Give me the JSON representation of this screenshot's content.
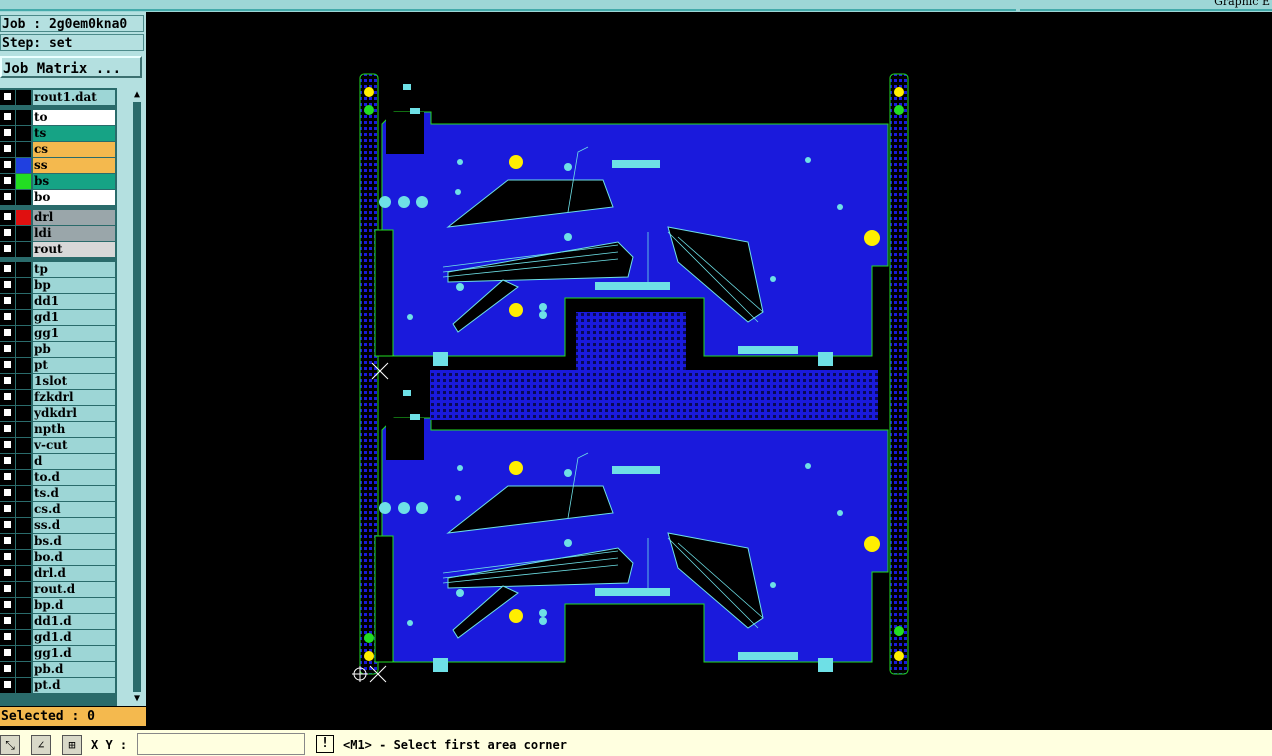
{
  "header": {
    "title": "Graphic E"
  },
  "job": {
    "job_label": "Job : 2g0em0kna0",
    "step_label": "Step: set"
  },
  "matrix_button": "Job Matrix ...",
  "layers": [
    {
      "name": "rout1.dat",
      "color": "#9dd6d6",
      "swatch": ""
    },
    {
      "name": "to",
      "color": "#ffffff",
      "swatch": ""
    },
    {
      "name": "ts",
      "color": "#16a385",
      "swatch": ""
    },
    {
      "name": "cs",
      "color": "#f4b94e",
      "swatch": ""
    },
    {
      "name": "ss",
      "color": "#f4b94e",
      "swatch": "#2040e0"
    },
    {
      "name": "bs",
      "color": "#16a385",
      "swatch": "#22dd22"
    },
    {
      "name": "bo",
      "color": "#ffffff",
      "swatch": ""
    },
    {
      "name": "drl",
      "color": "#9aa6aa",
      "swatch": "#e01010"
    },
    {
      "name": "ldi",
      "color": "#9aa6aa",
      "swatch": ""
    },
    {
      "name": "rout",
      "color": "#d8d8d8",
      "swatch": ""
    },
    {
      "name": "tp",
      "color": "#9dd6d6",
      "swatch": ""
    },
    {
      "name": "bp",
      "color": "#9dd6d6",
      "swatch": ""
    },
    {
      "name": "dd1",
      "color": "#9dd6d6",
      "swatch": ""
    },
    {
      "name": "gd1",
      "color": "#9dd6d6",
      "swatch": ""
    },
    {
      "name": "gg1",
      "color": "#9dd6d6",
      "swatch": ""
    },
    {
      "name": "pb",
      "color": "#9dd6d6",
      "swatch": ""
    },
    {
      "name": "pt",
      "color": "#9dd6d6",
      "swatch": ""
    },
    {
      "name": "1slot",
      "color": "#9dd6d6",
      "swatch": ""
    },
    {
      "name": "fzkdrl",
      "color": "#9dd6d6",
      "swatch": ""
    },
    {
      "name": "ydkdrl",
      "color": "#9dd6d6",
      "swatch": ""
    },
    {
      "name": "npth",
      "color": "#9dd6d6",
      "swatch": ""
    },
    {
      "name": "v-cut",
      "color": "#9dd6d6",
      "swatch": ""
    },
    {
      "name": "d",
      "color": "#9dd6d6",
      "swatch": ""
    },
    {
      "name": "to.d",
      "color": "#9dd6d6",
      "swatch": ""
    },
    {
      "name": "ts.d",
      "color": "#9dd6d6",
      "swatch": ""
    },
    {
      "name": "cs.d",
      "color": "#9dd6d6",
      "swatch": ""
    },
    {
      "name": "ss.d",
      "color": "#9dd6d6",
      "swatch": ""
    },
    {
      "name": "bs.d",
      "color": "#9dd6d6",
      "swatch": ""
    },
    {
      "name": "bo.d",
      "color": "#9dd6d6",
      "swatch": ""
    },
    {
      "name": "drl.d",
      "color": "#9dd6d6",
      "swatch": ""
    },
    {
      "name": "rout.d",
      "color": "#9dd6d6",
      "swatch": ""
    },
    {
      "name": "bp.d",
      "color": "#9dd6d6",
      "swatch": ""
    },
    {
      "name": "dd1.d",
      "color": "#9dd6d6",
      "swatch": ""
    },
    {
      "name": "gd1.d",
      "color": "#9dd6d6",
      "swatch": ""
    },
    {
      "name": "gg1.d",
      "color": "#9dd6d6",
      "swatch": ""
    },
    {
      "name": "pb.d",
      "color": "#9dd6d6",
      "swatch": ""
    },
    {
      "name": "pt.d",
      "color": "#9dd6d6",
      "swatch": ""
    }
  ],
  "status": {
    "selected": "Selected : 0"
  },
  "bottom": {
    "xy_label": "X Y :",
    "xy_value": "",
    "info_icon": "!",
    "message": "<M1> - Select first area corner"
  },
  "colors": {
    "copper": "#1a1adc",
    "outline": "#22dd22",
    "pad": "#6ee0e6",
    "hole": "#ffee00",
    "background": "#000000"
  }
}
